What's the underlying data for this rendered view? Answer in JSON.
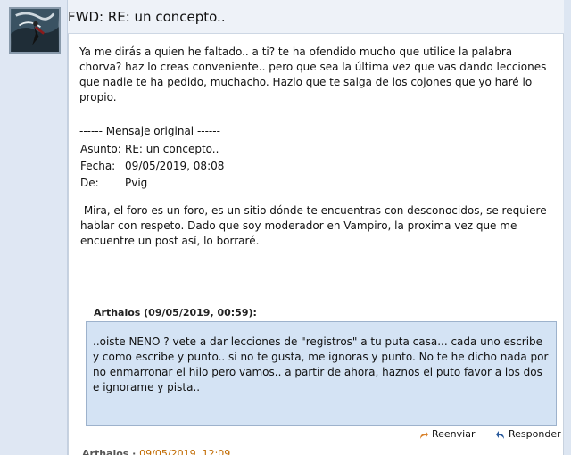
{
  "message": {
    "subject": "FWD: RE: un concepto..",
    "body": "Ya me dirás a quien he faltado.. a ti? te ha ofendido mucho que utilice la palabra chorva? haz lo creas conveniente.. pero que sea la última vez que vas dando lecciones que nadie te ha pedido, muchacho. Hazlo que te salga de los cojones que yo haré lo propio."
  },
  "original": {
    "title": "------ Mensaje original ------",
    "asunto_label": "Asunto:",
    "asunto_value": "RE: un concepto..",
    "fecha_label": "Fecha:",
    "fecha_value": "09/05/2019, 08:08",
    "de_label": "De:",
    "de_value": "Pvig",
    "body": " Mira, el foro es un foro, es un sitio dónde te encuentras con desconocidos, se requiere hablar con respeto. Dado que soy moderador en Vampiro, la proxima vez que me encuentre un post así, lo borraré."
  },
  "quote": {
    "author": "Arthaios (09/05/2019, 00:59):",
    "text": "..oiste  NENO ? vete a dar lecciones de \"registros\" a tu puta casa... cada uno escribe y como escribe y punto.. si no te gusta, me ignoras y punto. No te he dicho nada por no enmarronar el hilo pero vamos.. a partir de ahora, haznos el puto favor a los dos e ignorame y pista.."
  },
  "actions": {
    "forward_label": "Reenviar",
    "reply_label": "Responder"
  },
  "next": {
    "author": "Arthaios",
    "separator": " · ",
    "date": "09/05/2019, 12:09"
  },
  "colors": {
    "quote_bg": "#d4e3f4",
    "forward_icon": "#d9822b",
    "reply_icon": "#2a5a9c"
  }
}
